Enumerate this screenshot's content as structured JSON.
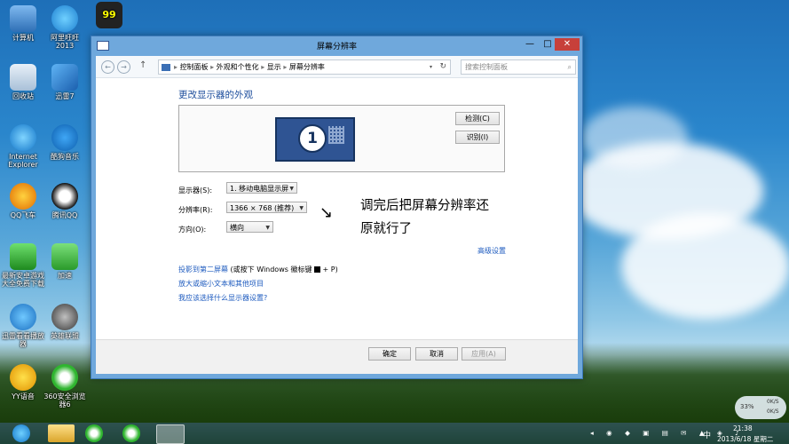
{
  "desktop": {
    "icons": [
      {
        "label": "计算机"
      },
      {
        "label": "阿里旺旺\n2013"
      },
      {
        "label": "99"
      },
      {
        "label": "回收站"
      },
      {
        "label": "迅雷7"
      },
      {
        "label": "Internet\nExplorer"
      },
      {
        "label": "酷狗音乐"
      },
      {
        "label": "QQ飞车"
      },
      {
        "label": "腾讯QQ"
      },
      {
        "label": "最新安卓游戏\n大全免费下载"
      },
      {
        "label": "加速"
      },
      {
        "label": "迅雷看看播放\n器"
      },
      {
        "label": "英雄联盟"
      },
      {
        "label": "YY语音"
      },
      {
        "label": "360安全浏览\n器6"
      }
    ]
  },
  "window": {
    "title": "屏幕分辨率",
    "minimize": "—",
    "maximize": "□",
    "close": "✕",
    "breadcrumb": [
      "控制面板",
      "外观和个性化",
      "显示",
      "屏幕分辨率"
    ],
    "search_placeholder": "搜索控制面板",
    "heading": "更改显示器的外观",
    "monitor_number": "1",
    "detect_button": "检测(C)",
    "identify_button": "识别(I)",
    "display_label": "显示器(S):",
    "display_value": "1. 移动电脑显示屏",
    "resolution_label": "分辨率(R):",
    "resolution_value": "1366 × 768 (推荐)",
    "orientation_label": "方向(O):",
    "orientation_value": "横向",
    "advanced_link": "高级设置",
    "link_projector_1": "投影到第二屏幕",
    "link_projector_2": " (或按下 Windows 徽标键 ",
    "link_projector_3": " + P)",
    "link_text_size": "放大或缩小文本和其他项目",
    "link_which_settings": "我应该选择什么显示器设置?",
    "ok_button": "确定",
    "cancel_button": "取消",
    "apply_button": "应用(A)"
  },
  "annotation": {
    "arrow": "↘",
    "text_line1": "调完后把屏幕分辨率还",
    "text_line2": "原就行了"
  },
  "gadget": {
    "percent": "33%",
    "up": "0K/S",
    "down": "0K/S"
  },
  "taskbar": {
    "ime": "中",
    "time": "21:38",
    "date": "2013/6/18 星期二"
  }
}
